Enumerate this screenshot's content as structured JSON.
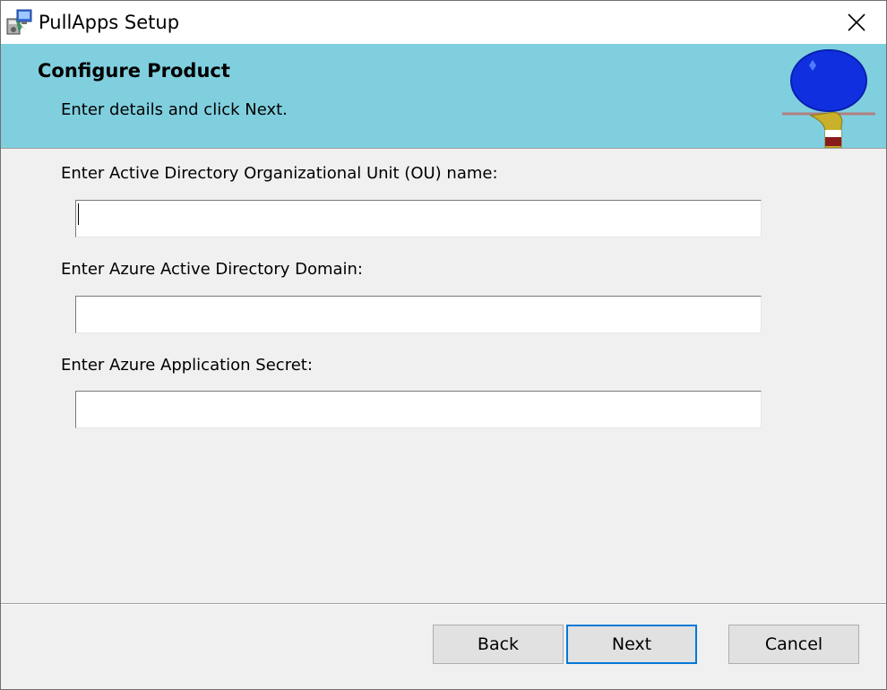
{
  "window": {
    "title": "PullApps Setup",
    "close_glyph": "✕"
  },
  "banner": {
    "title": "Configure Product",
    "subtitle": "Enter details and click Next."
  },
  "form": {
    "fields": [
      {
        "label": "Enter Active Directory Organizational Unit (OU) name:",
        "value": ""
      },
      {
        "label": "Enter Azure Active Directory Domain:",
        "value": ""
      },
      {
        "label": "Enter Azure Application Secret:",
        "value": ""
      }
    ]
  },
  "buttons": {
    "back": "Back",
    "next": "Next",
    "cancel": "Cancel"
  },
  "colors": {
    "banner": "#80cfde",
    "default_button_border": "#0078d7"
  }
}
